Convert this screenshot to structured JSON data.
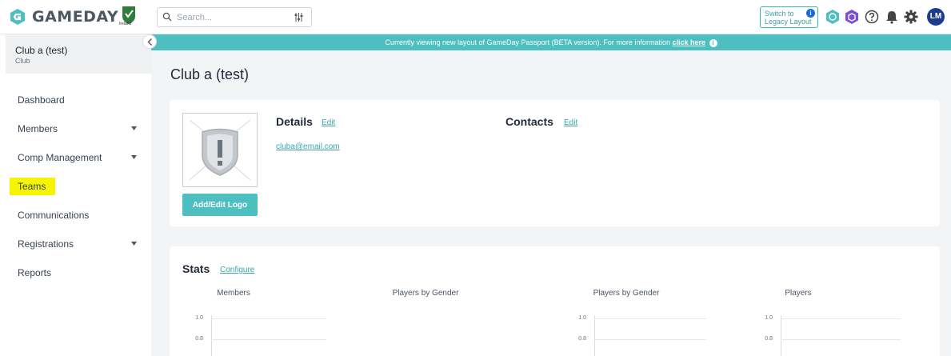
{
  "brand": {
    "name": "GAMEDAY",
    "partner_label": "Ireland",
    "accent": "#4dbfc1",
    "navy": "#1e3c8c"
  },
  "search": {
    "placeholder": "Search..."
  },
  "header": {
    "switch_line1": "Switch to",
    "switch_line2": "Legacy Layout",
    "switch_badge": "i",
    "avatar_initials": "LM",
    "icons": [
      "passport-icon",
      "purple-hex-icon",
      "help-icon",
      "bell-icon",
      "gear-icon"
    ]
  },
  "sidebar": {
    "club_name": "Club a (test)",
    "club_type": "Club",
    "items": [
      {
        "label": "Dashboard",
        "has_caret": false
      },
      {
        "label": "Members",
        "has_caret": true
      },
      {
        "label": "Comp Management",
        "has_caret": true
      },
      {
        "label": "Teams",
        "has_caret": false,
        "highlighted": true
      },
      {
        "label": "Communications",
        "has_caret": false
      },
      {
        "label": "Registrations",
        "has_caret": true
      },
      {
        "label": "Reports",
        "has_caret": false
      }
    ]
  },
  "banner": {
    "text": "Currently viewing new layout of GameDay Passport (BETA version). For more information ",
    "link": "click here",
    "badge": "i"
  },
  "main": {
    "title": "Club a (test)",
    "details": {
      "title": "Details",
      "edit": "Edit",
      "email": "cluba@email.com",
      "logo_button": "Add/Edit Logo"
    },
    "contacts": {
      "title": "Contacts",
      "edit": "Edit"
    },
    "stats": {
      "title": "Stats",
      "configure": "Configure",
      "charts": [
        {
          "title": "Members",
          "ticks": [
            "1.0",
            "0.8"
          ],
          "has_axis": true
        },
        {
          "title": "Players by Gender",
          "ticks": [],
          "has_axis": false
        },
        {
          "title": "Players by Gender",
          "ticks": [
            "1.0",
            "0.8"
          ],
          "has_axis": true
        },
        {
          "title": "Players",
          "ticks": [
            "1.0",
            "0.8"
          ],
          "has_axis": true
        }
      ]
    }
  }
}
